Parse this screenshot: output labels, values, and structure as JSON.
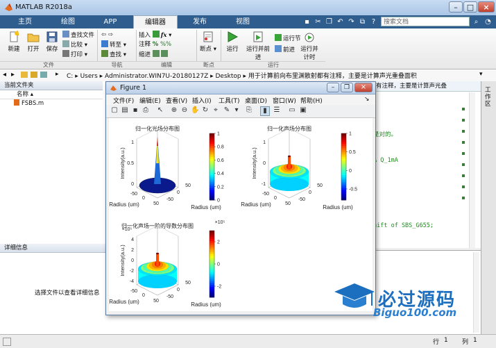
{
  "window": {
    "title": "MATLAB R2018a"
  },
  "tabs": [
    {
      "label": "主页"
    },
    {
      "label": "绘图"
    },
    {
      "label": "APP"
    },
    {
      "label": "编辑器"
    },
    {
      "label": "发布"
    },
    {
      "label": "视图"
    }
  ],
  "search": {
    "placeholder": "搜索文档"
  },
  "ribbon": {
    "new": "新建",
    "open": "打开",
    "save": "保存",
    "find_files": "查找文件",
    "compare": "比较",
    "print": "打印",
    "goto": "转至",
    "find": "查找",
    "insert": "插入",
    "comment": "注释",
    "indent": "缩进",
    "breakpoints": "断点",
    "run": "运行",
    "run_advance": "运行并前进",
    "run_section": "运行节",
    "advance": "前进",
    "run_time": "运行并计时",
    "groups": {
      "file": "文件",
      "navigate": "导航",
      "edit": "编辑",
      "breakpoints": "断点",
      "run": "运行"
    }
  },
  "address": {
    "parts": [
      "C:",
      "Users",
      "Administrator.WIN7U-20180127Z",
      "Desktop",
      "用于计算前向布里渊散射都有注释，主要是计算声光重叠面积"
    ]
  },
  "current_folder": {
    "title": "当前文件夹",
    "col_name": "名称",
    "files": [
      "FSBS.m"
    ]
  },
  "details": {
    "title": "详细信息",
    "hint": "选择文件以查看详细信息"
  },
  "editor": {
    "peek_title": "有注释，主要是计算声光叠",
    "lines": [
      "是对的。",
      "A Q_1mA",
      "aift of SBS_G655;"
    ]
  },
  "right_panel": {
    "label": "工作区"
  },
  "status": {
    "row_label": "行",
    "row": "1",
    "col_label": "列",
    "col": "1"
  },
  "figure": {
    "title": "Figure 1",
    "menu": [
      "文件(F)",
      "编辑(E)",
      "查看(V)",
      "插入(I)",
      "工具(T)",
      "桌面(D)",
      "窗口(W)",
      "帮助(H)"
    ]
  },
  "chart_data": [
    {
      "type": "surface",
      "title": "归一化光场分布图",
      "xlabel": "Radius (um)",
      "ylabel": "Radius (um)",
      "zlabel": "Intensity(a.u.)",
      "x_ticks": [
        "-50",
        "0",
        "50"
      ],
      "y_ticks": [
        "-50",
        "0",
        "50"
      ],
      "z_ticks": [
        "0",
        "0.5",
        "1"
      ],
      "colorbar_ticks": [
        "1",
        "0.8",
        "0.6",
        "0.4",
        "0.2",
        "0"
      ],
      "colorbar_range": [
        0,
        1
      ]
    },
    {
      "type": "surface",
      "title": "归一化声场分布图",
      "xlabel": "Radius (um)",
      "ylabel": "Radius (um)",
      "zlabel": "Intensity(a.u.)",
      "x_ticks": [
        "-50",
        "0",
        "50"
      ],
      "y_ticks": [
        "-50",
        "0",
        "50"
      ],
      "z_ticks": [
        "-1",
        "0",
        "1"
      ],
      "colorbar_ticks": [
        "1",
        "0.5",
        "0",
        "-0.5"
      ],
      "colorbar_range": [
        -0.8,
        1
      ]
    },
    {
      "type": "surface",
      "title": "归一化声场一阶的导数分布图",
      "exponent": "×10⁵",
      "xlabel": "Radius (um)",
      "ylabel": "Radius (um)",
      "zlabel": "Intensity(a.u.)",
      "x_ticks": [
        "-50",
        "0",
        "50"
      ],
      "y_ticks": [
        "-50",
        "0",
        "50"
      ],
      "z_ticks": [
        "-4",
        "-2",
        "0",
        "2",
        "4"
      ],
      "colorbar_ticks": [
        "2",
        "0",
        "-2"
      ],
      "colorbar_range": [
        -3,
        3
      ]
    }
  ],
  "watermark": {
    "text": "必过源码",
    "sub": "Biguo100.com"
  }
}
